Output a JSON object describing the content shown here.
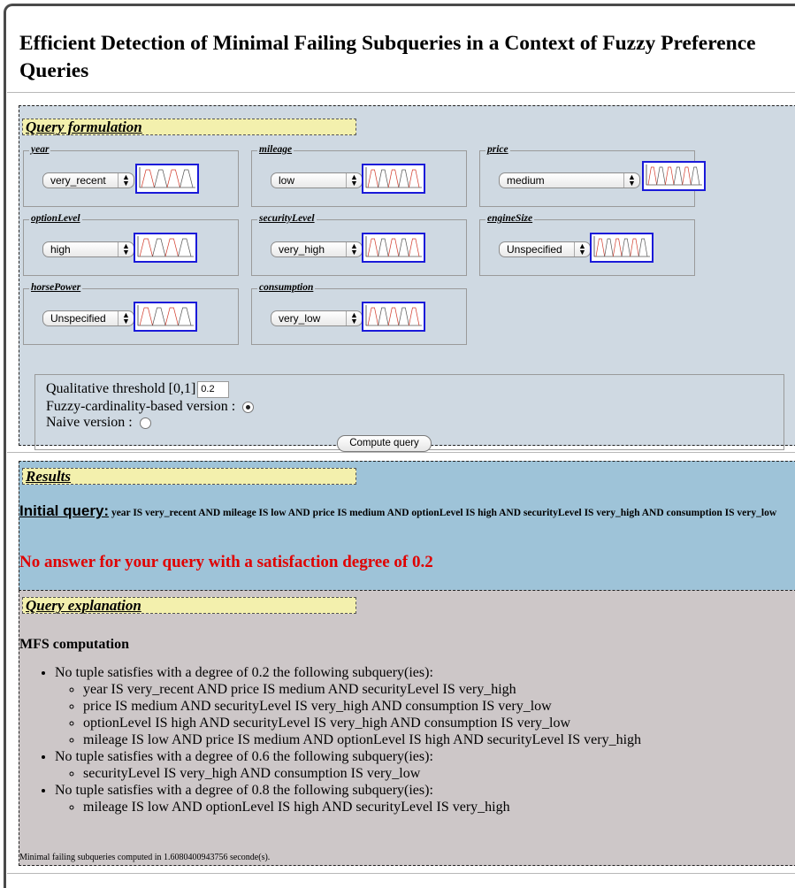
{
  "page": {
    "title": "Efficient Detection of Minimal Failing Subqueries in a Context of Fuzzy Preference Queries"
  },
  "query_formulation": {
    "title": "Query formulation",
    "attributes": [
      {
        "label": "year",
        "value": "very_recent"
      },
      {
        "label": "mileage",
        "value": "low"
      },
      {
        "label": "price",
        "value": "medium"
      },
      {
        "label": "optionLevel",
        "value": "high"
      },
      {
        "label": "securityLevel",
        "value": "very_high"
      },
      {
        "label": "engineSize",
        "value": "Unspecified"
      },
      {
        "label": "horsePower",
        "value": "Unspecified"
      },
      {
        "label": "consumption",
        "value": "very_low"
      }
    ],
    "threshold_label": "Qualitative threshold [0,1]",
    "threshold_value": "0.2",
    "fuzzy_label": "Fuzzy-cardinality-based version :",
    "naive_label": "Naive version :",
    "compute_button": "Compute query",
    "selected_version": "fuzzy"
  },
  "results": {
    "title": "Results",
    "initial_label": "Initial query:",
    "initial_query": "year IS very_recent AND mileage IS low AND price IS medium AND optionLevel IS high AND securityLevel IS very_high AND consumption IS very_low",
    "no_answer": "No answer for your query with a satisfaction degree of 0.2"
  },
  "explanation": {
    "title": "Query explanation",
    "heading": "MFS computation",
    "groups": [
      {
        "text": "No tuple satisfies with a degree of 0.2 the following subquery(ies):",
        "items": [
          "year IS very_recent AND price IS medium AND securityLevel IS very_high",
          "price IS medium AND securityLevel IS very_high AND consumption IS very_low",
          "optionLevel IS high AND securityLevel IS very_high AND consumption IS very_low",
          "mileage IS low AND price IS medium AND optionLevel IS high AND securityLevel IS very_high"
        ]
      },
      {
        "text": "No tuple satisfies with a degree of 0.6 the following subquery(ies):",
        "items": [
          "securityLevel IS very_high AND consumption IS very_low"
        ]
      },
      {
        "text": "No tuple satisfies with a degree of 0.8 the following subquery(ies):",
        "items": [
          "mileage IS low AND optionLevel IS high AND securityLevel IS very_high"
        ]
      }
    ],
    "footer": "Minimal failing subqueries computed in 1.6080400943756 seconde(s)."
  },
  "colors": {
    "query_bg": "#cfd9e2",
    "results_bg": "#9ec3d8",
    "explanation_bg": "#cdc7c8",
    "title_bg": "#f3f0ad",
    "graph_border": "#1a1ad9",
    "no_answer": "#e00000"
  }
}
